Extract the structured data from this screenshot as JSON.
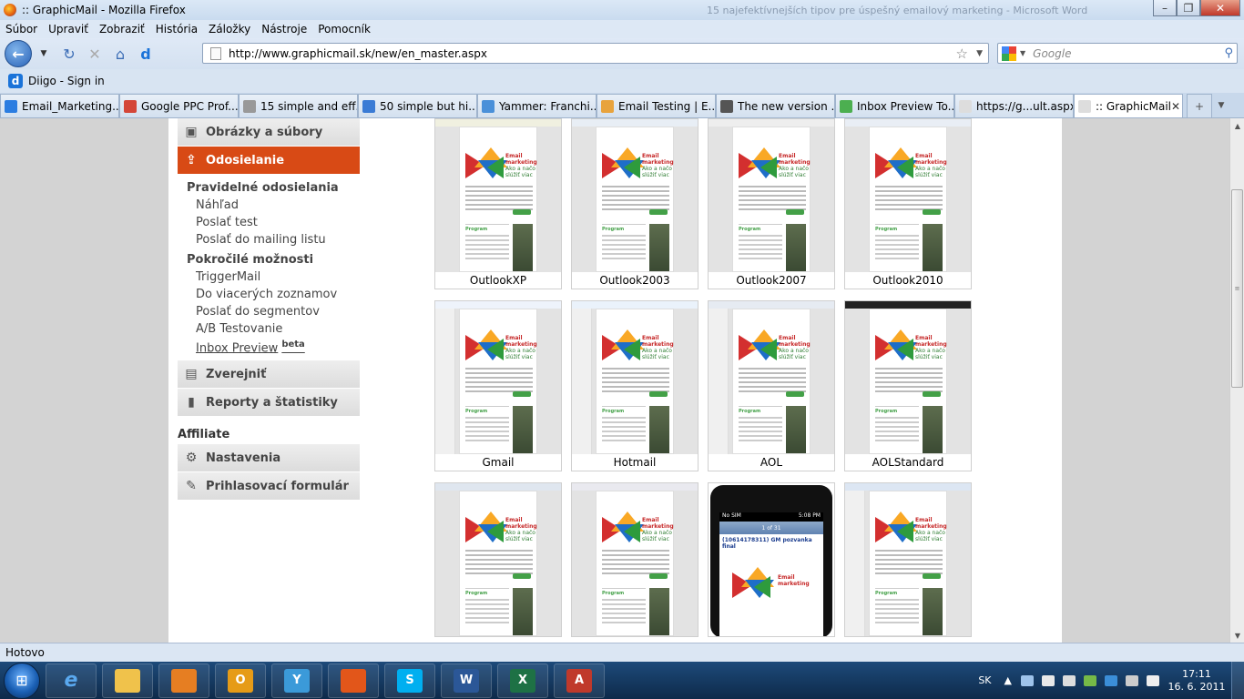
{
  "window": {
    "title": ":: GraphicMail - Mozilla Firefox",
    "background_title": "15 najefektívnejších tipov pre úspešný emailový marketing - Microsoft Word"
  },
  "menu": [
    "Súbor",
    "Upraviť",
    "Zobraziť",
    "História",
    "Záložky",
    "Nástroje",
    "Pomocník"
  ],
  "address": {
    "url": "http://www.graphicmail.sk/new/en_master.aspx",
    "search_placeholder": "Google"
  },
  "bookmarks": {
    "diigo_label": "Diigo - Sign in"
  },
  "tabs": [
    {
      "label": "Email_Marketing...",
      "color": "#2b7de1"
    },
    {
      "label": "Google PPC Prof...",
      "color": "#d44638"
    },
    {
      "label": "15 simple and eff...",
      "color": "#999999"
    },
    {
      "label": "50 simple but hi...",
      "color": "#3a7bd5"
    },
    {
      "label": "Yammer: Franchi...",
      "color": "#4a90d9"
    },
    {
      "label": "Email Testing | E...",
      "color": "#e8a33d"
    },
    {
      "label": "The new version ...",
      "color": "#555555"
    },
    {
      "label": "Inbox Preview To...",
      "color": "#4caf50"
    },
    {
      "label": "https://g...ult.aspx",
      "color": "#dddddd"
    },
    {
      "label": ":: GraphicMail",
      "color": "#dddddd",
      "active": true
    }
  ],
  "sidebar": {
    "top_items": [
      {
        "label": "Obrázky a súbory",
        "icon": "image-icon"
      },
      {
        "label": "Odosielanie",
        "icon": "send-icon",
        "active": true
      }
    ],
    "sections": [
      {
        "heading": "Pravidelné odosielania",
        "items": [
          "Náhľad",
          "Poslať test",
          "Poslať do mailing listu"
        ]
      },
      {
        "heading": "Pokročilé možnosti",
        "items": [
          "TriggerMail",
          "Do viacerých zoznamov",
          "Poslať do segmentov",
          "A/B Testovanie"
        ]
      }
    ],
    "inbox_preview": "Inbox Preview",
    "beta": "beta",
    "mid_items": [
      {
        "label": "Zverejniť",
        "icon": "publish-icon"
      },
      {
        "label": "Reporty a štatistiky",
        "icon": "chart-icon"
      }
    ],
    "affiliate": "Affiliate",
    "bottom_items": [
      {
        "label": "Nastavenia",
        "icon": "gear-icon"
      },
      {
        "label": "Prihlasovací formulár",
        "icon": "form-icon"
      }
    ]
  },
  "previews": [
    {
      "label": "OutlookXP"
    },
    {
      "label": "Outlook2003"
    },
    {
      "label": "Outlook2007"
    },
    {
      "label": "Outlook2010"
    },
    {
      "label": "Gmail"
    },
    {
      "label": "Hotmail"
    },
    {
      "label": "AOL"
    },
    {
      "label": "AOLStandard"
    }
  ],
  "preview_text": {
    "email_title": "Email marketing",
    "email_sub": "Ako a načo slúžiť viac",
    "program": "Program",
    "phone_time": "5:08 PM",
    "phone_carrier": "No SIM",
    "phone_header": "1 of 31",
    "phone_subject": "(10614178311) GM pozvanka final"
  },
  "status": "Hotovo",
  "taskbar": {
    "lang": "SK",
    "time": "17:11",
    "date": "16. 6. 2011",
    "apps": [
      {
        "name": "explorer-icon",
        "color": "#f0c24b",
        "label": ""
      },
      {
        "name": "media-icon",
        "color": "#e67e22",
        "label": ""
      },
      {
        "name": "outlook-icon",
        "color": "#e69b17",
        "label": "O"
      },
      {
        "name": "yammer-icon",
        "color": "#3b9ad9",
        "label": "Y"
      },
      {
        "name": "firefox-icon",
        "color": "#e2561a",
        "label": ""
      },
      {
        "name": "skype-icon",
        "color": "#00aff0",
        "label": "S"
      },
      {
        "name": "word-icon",
        "color": "#2b5797",
        "label": "W"
      },
      {
        "name": "excel-icon",
        "color": "#1e7145",
        "label": "X"
      },
      {
        "name": "acrobat-icon",
        "color": "#c0392b",
        "label": "A"
      }
    ]
  }
}
